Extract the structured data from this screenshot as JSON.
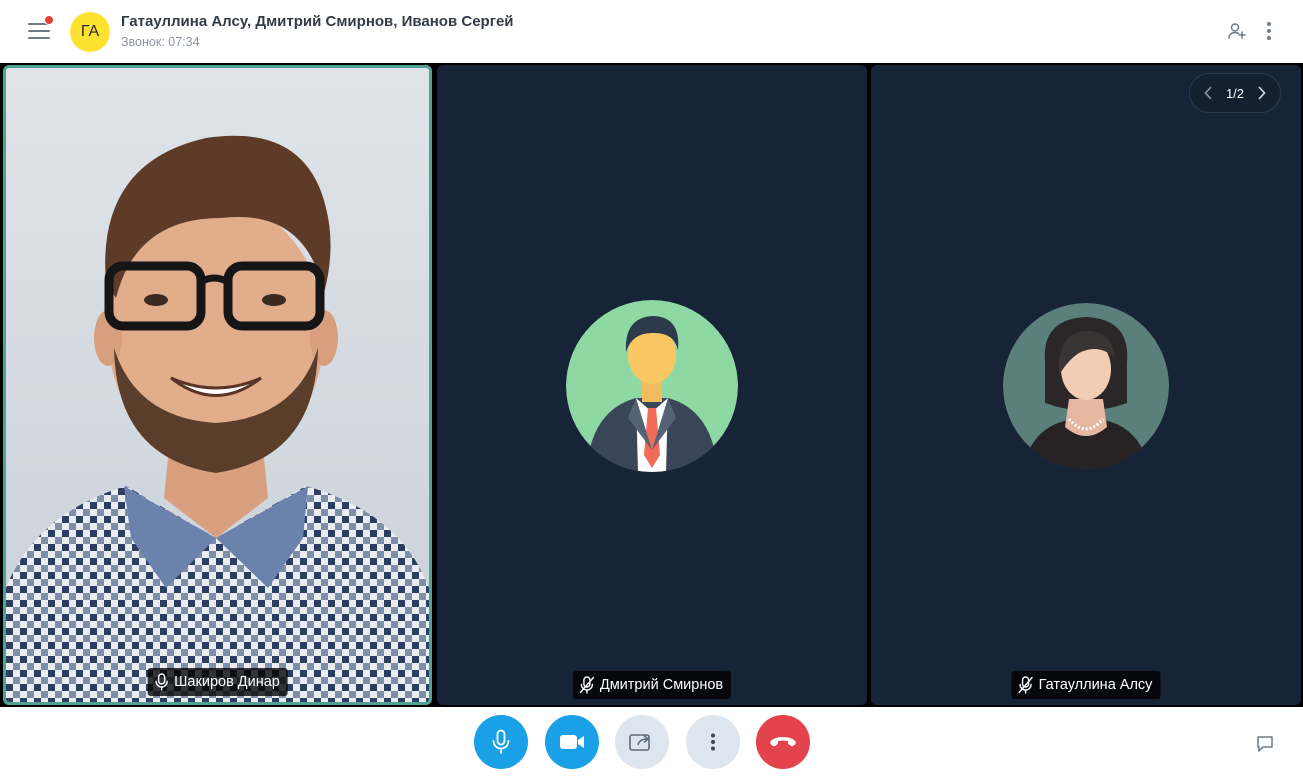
{
  "header": {
    "avatar_initials": "ГА",
    "title": "Гатауллина Алсу, Дмитрий Смирнов, Иванов Сергей",
    "subtitle": "Звонок: 07:34",
    "notification_dot_color": "#e5413b",
    "avatar_color": "#fde22f",
    "icons": [
      "menu-icon",
      "add-user-icon",
      "more-vertical-icon"
    ]
  },
  "participants": [
    {
      "name": "Шакиров Динар",
      "mic": "on",
      "video": "on",
      "active_speaker": true
    },
    {
      "name": "Дмитрий Смирнов",
      "mic": "muted",
      "video": "off",
      "avatar": "man-avatar"
    },
    {
      "name": "Гатауллина Алсу",
      "mic": "muted",
      "video": "off",
      "avatar": "woman-avatar"
    }
  ],
  "pagination": {
    "label": "1/2"
  },
  "controls": [
    {
      "id": "microphone",
      "icon": "microphone-icon",
      "color": "#1aa0e6"
    },
    {
      "id": "camera",
      "icon": "camera-icon",
      "color": "#1aa0e6"
    },
    {
      "id": "screen-share",
      "icon": "screen-share-icon",
      "color": "#dde5ee"
    },
    {
      "id": "more",
      "icon": "more-vertical-icon",
      "color": "#dde5ee"
    },
    {
      "id": "hang-up",
      "icon": "phone-hangup-icon",
      "color": "#e3434c"
    }
  ],
  "colors": {
    "tile_bg": "#172336",
    "active_border": "#4ea395",
    "stage_bg": "#000000"
  }
}
